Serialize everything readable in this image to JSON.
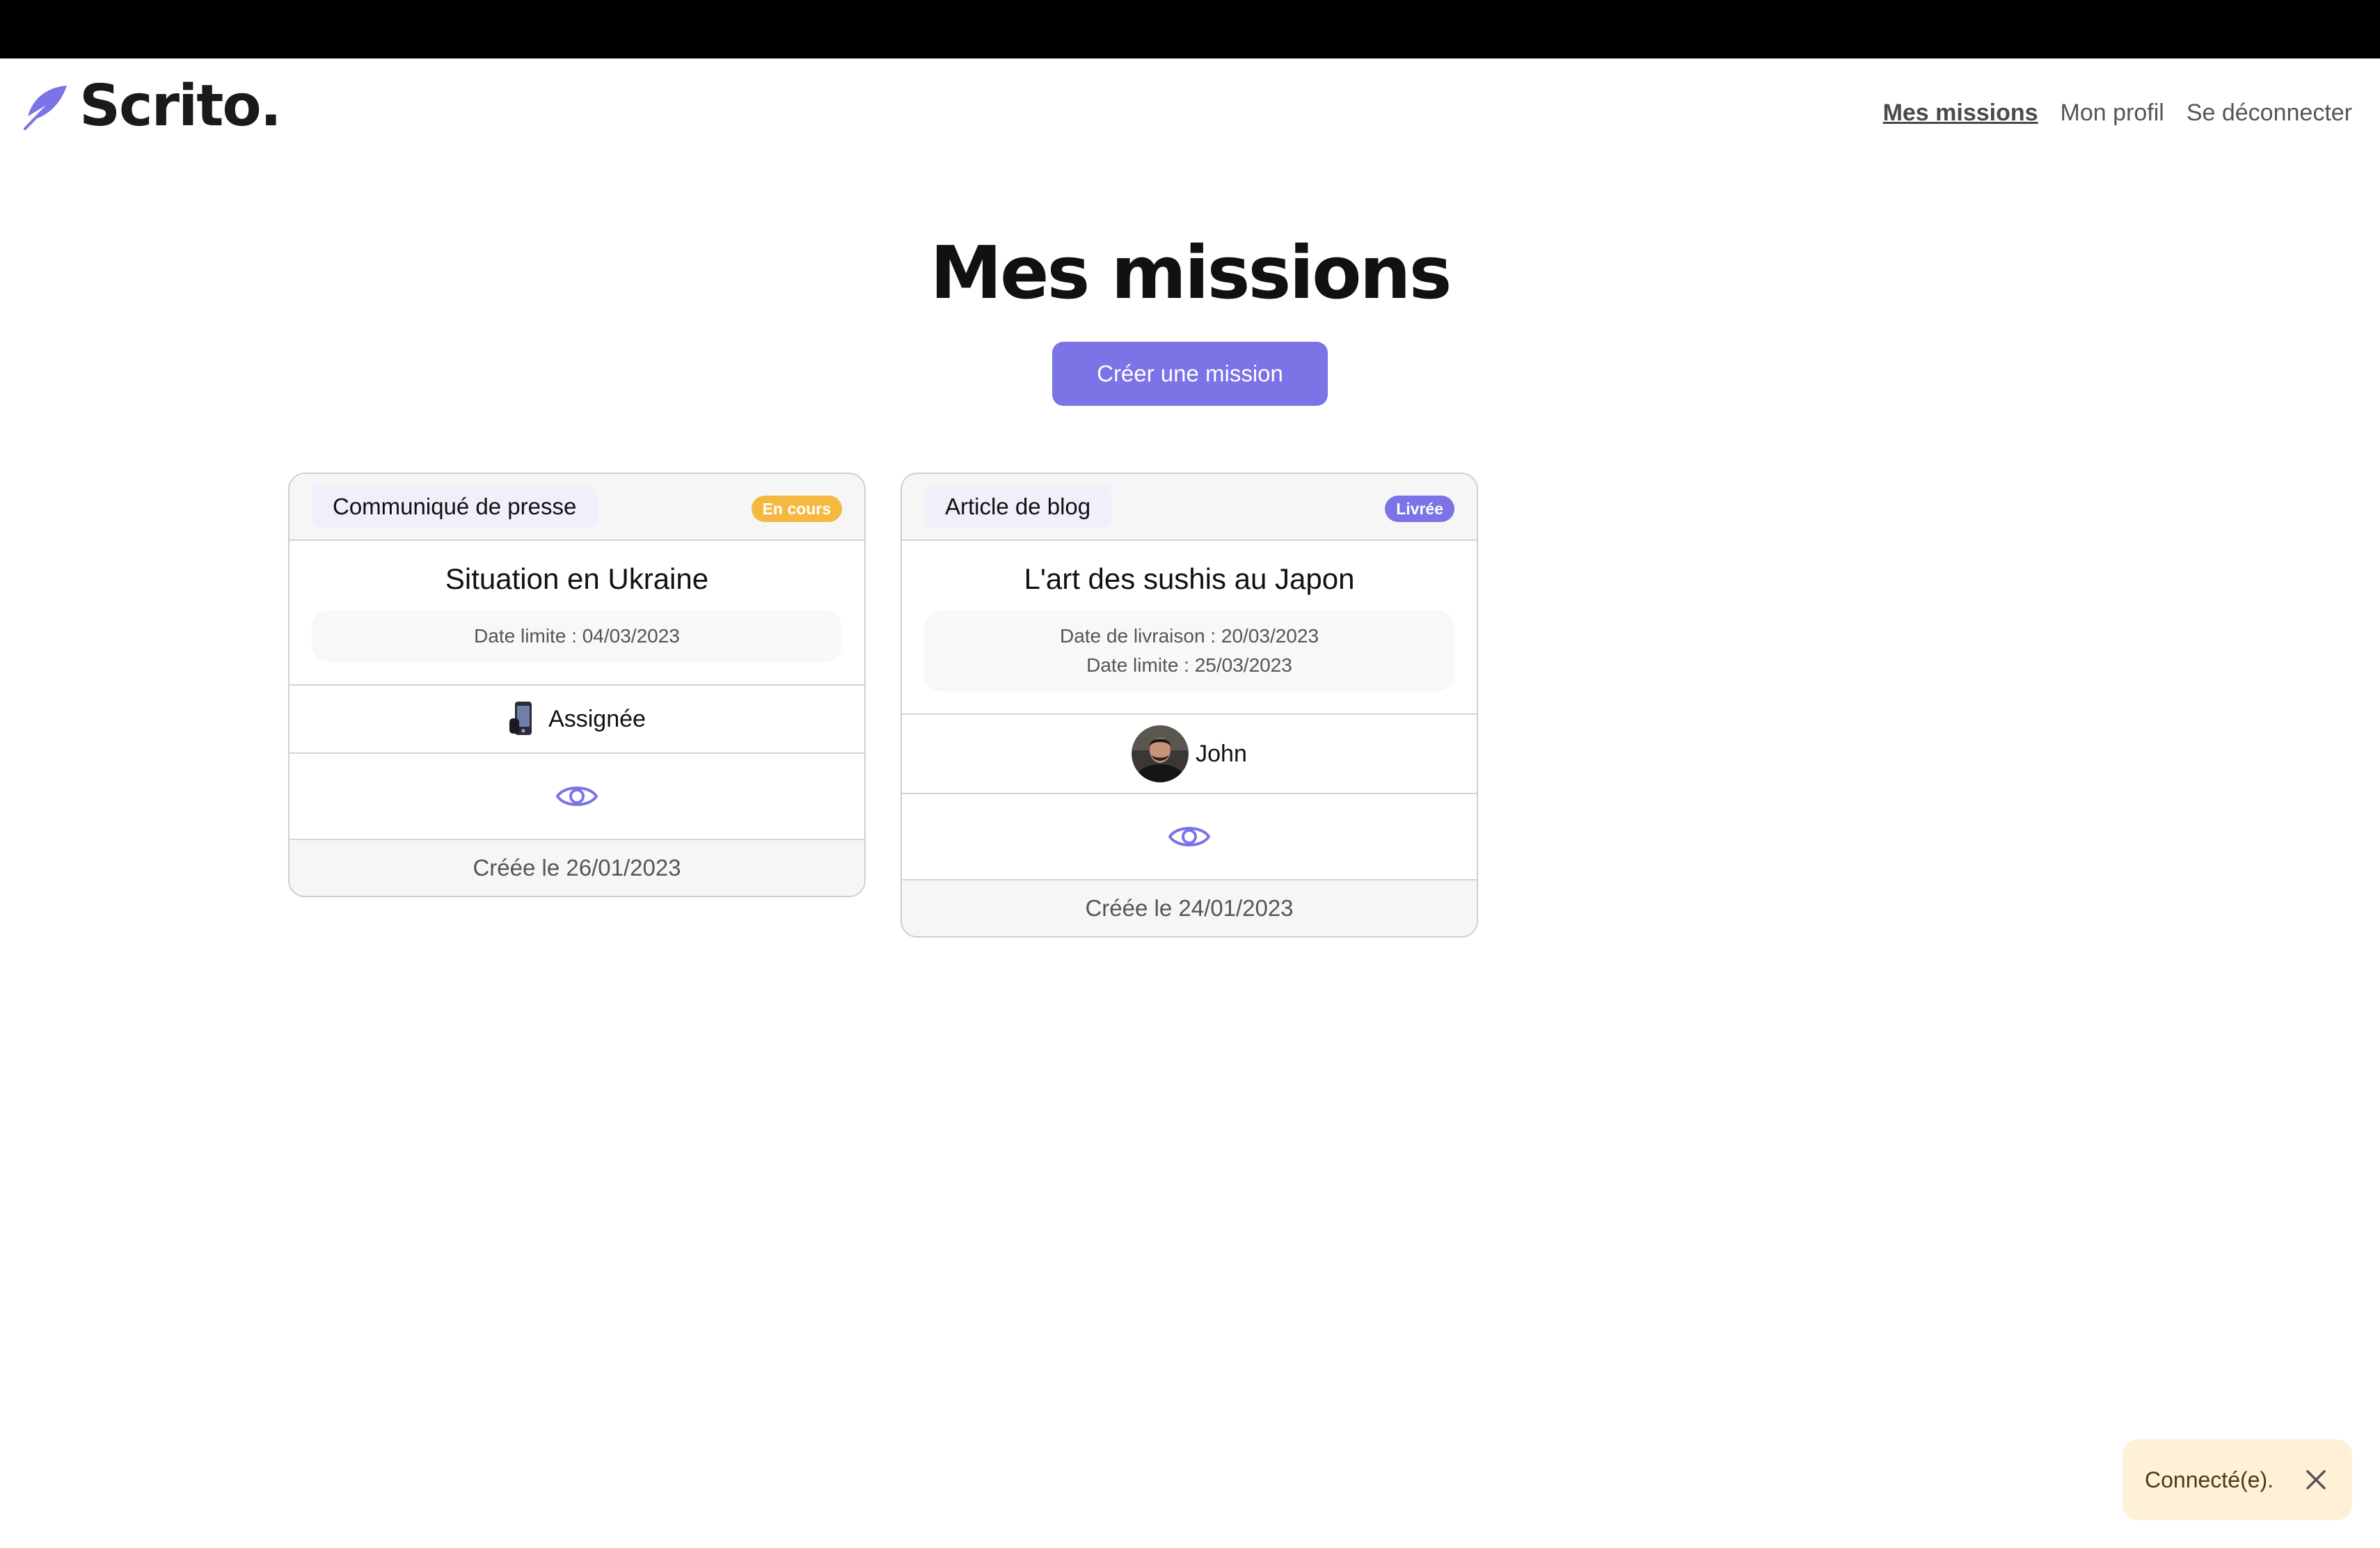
{
  "brand": {
    "name": "Scrito.",
    "icon": "feather-icon",
    "color": "#7b73e6"
  },
  "nav": {
    "items": [
      {
        "label": "Mes missions",
        "active": true
      },
      {
        "label": "Mon profil",
        "active": false
      },
      {
        "label": "Se déconnecter",
        "active": false
      }
    ]
  },
  "page": {
    "title": "Mes missions",
    "create_button": "Créer une mission"
  },
  "missions": [
    {
      "type": "Communiqué de presse",
      "status": "En cours",
      "status_color": "#f5b841",
      "title": "Situation en Ukraine",
      "dates": [
        "Date limite : 04/03/2023"
      ],
      "assignee_icon": "mobile-phone-icon",
      "assignee": "Assignée",
      "view_icon": "eye-icon",
      "created": "Créée le 26/01/2023"
    },
    {
      "type": "Article de blog",
      "status": "Livrée",
      "status_color": "#7b73e6",
      "title": "L'art des sushis au Japon",
      "dates": [
        "Date de livraison : 20/03/2023",
        "Date limite : 25/03/2023"
      ],
      "assignee_icon": "avatar",
      "assignee": "John",
      "view_icon": "eye-icon",
      "created": "Créée le 24/01/2023"
    }
  ],
  "toast": {
    "message": "Connecté(e).",
    "close_icon": "close-icon"
  }
}
